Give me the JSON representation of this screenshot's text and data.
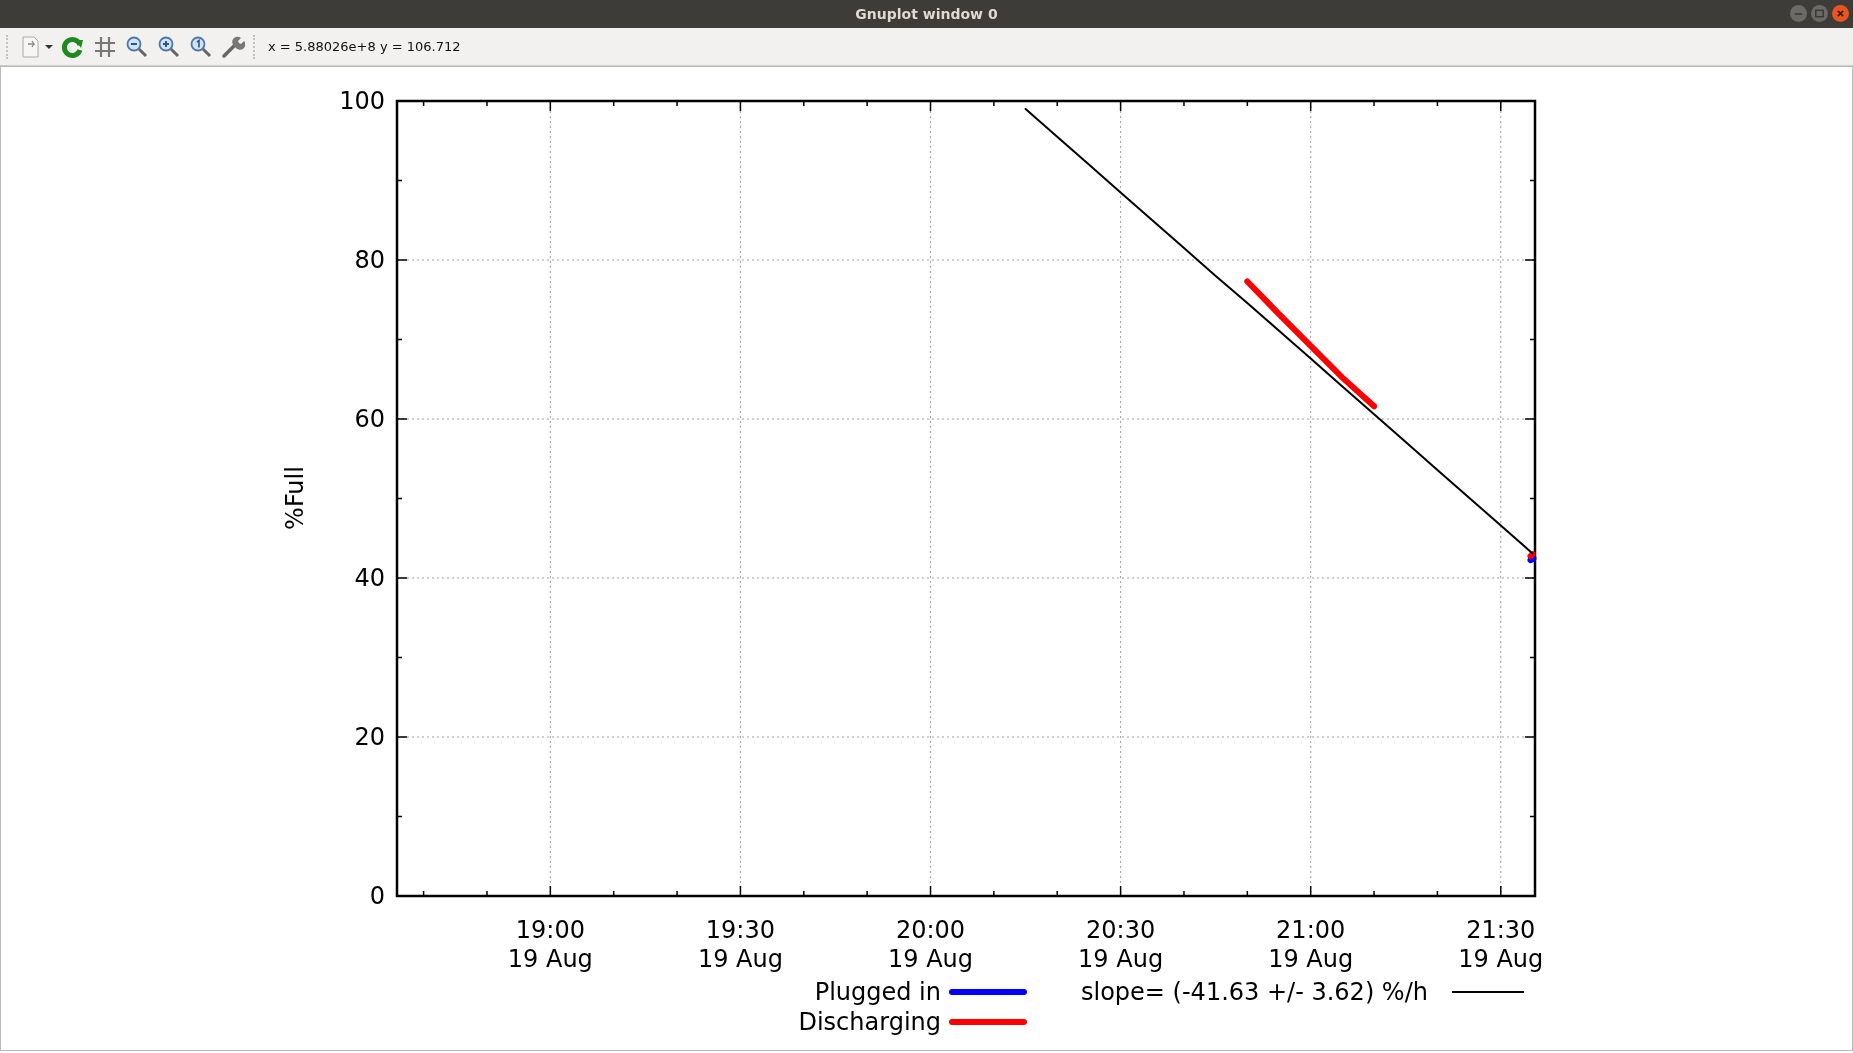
{
  "window": {
    "title": "Gnuplot window 0"
  },
  "toolbar": {
    "coordinates": "x = 5.88026e+8 y = 106.712"
  },
  "plot": {
    "chart_data": {
      "type": "line",
      "grid": true,
      "legend": true,
      "ylabel": "%Full",
      "ylim": [
        0,
        100
      ],
      "yticks": [
        0,
        20,
        40,
        60,
        80,
        100
      ],
      "categories": [
        null,
        null,
        null,
        null,
        "19:00\n19 Aug",
        null,
        null,
        null,
        null,
        null,
        "19:30\n19 Aug",
        null,
        null,
        null,
        null,
        null,
        "20:00\n19 Aug",
        null,
        null,
        null,
        null,
        null,
        "20:30\n19 Aug",
        null,
        null,
        null,
        null,
        null,
        "21:00\n19 Aug",
        null,
        null,
        null,
        null,
        null,
        "21:30\n19 Aug",
        null
      ],
      "series": [
        {
          "name": "Plugged in",
          "color": "#0000ff",
          "marker": "dot",
          "values": [
            null,
            null,
            null,
            null,
            null,
            null,
            null,
            null,
            null,
            null,
            null,
            null,
            null,
            null,
            null,
            null,
            null,
            null,
            null,
            null,
            null,
            null,
            null,
            null,
            null,
            null,
            null,
            null,
            null,
            null,
            null,
            null,
            null,
            null,
            null,
            42.5
          ]
        },
        {
          "name": "Discharging",
          "color": "#ff0000",
          "values": [
            null,
            null,
            null,
            null,
            null,
            null,
            null,
            null,
            null,
            null,
            null,
            null,
            null,
            null,
            null,
            null,
            null,
            null,
            null,
            null,
            null,
            null,
            null,
            null,
            null,
            null,
            77.3,
            73.2,
            69.2,
            65.2,
            61.6,
            null,
            null,
            null,
            null,
            43.0
          ]
        },
        {
          "name": "slope= (-41.63 +/- 3.62) %/h",
          "color": "#000000",
          "values": [
            null,
            null,
            null,
            null,
            null,
            null,
            null,
            null,
            null,
            null,
            null,
            null,
            null,
            null,
            null,
            null,
            null,
            null,
            null,
            99.0,
            95.5,
            92.0,
            88.5,
            85.0,
            81.5,
            78.0,
            74.6,
            71.1,
            67.6,
            64.1,
            60.6,
            57.1,
            53.6,
            50.1,
            46.6,
            43.1
          ]
        }
      ]
    }
  }
}
